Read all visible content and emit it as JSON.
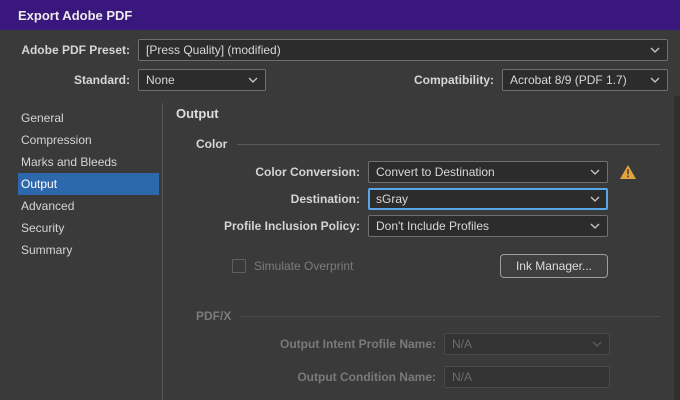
{
  "title": "Export Adobe PDF",
  "top": {
    "preset_label": "Adobe PDF Preset:",
    "preset_value": "[Press Quality] (modified)",
    "standard_label": "Standard:",
    "standard_value": "None",
    "compatibility_label": "Compatibility:",
    "compatibility_value": "Acrobat 8/9 (PDF 1.7)"
  },
  "sidebar": {
    "items": [
      {
        "label": "General",
        "selected": false
      },
      {
        "label": "Compression",
        "selected": false
      },
      {
        "label": "Marks and Bleeds",
        "selected": false
      },
      {
        "label": "Output",
        "selected": true
      },
      {
        "label": "Advanced",
        "selected": false
      },
      {
        "label": "Security",
        "selected": false
      },
      {
        "label": "Summary",
        "selected": false
      }
    ]
  },
  "panel": {
    "title": "Output",
    "color": {
      "title": "Color",
      "conversion_label": "Color Conversion:",
      "conversion_value": "Convert to Destination",
      "destination_label": "Destination:",
      "destination_value": "sGray",
      "policy_label": "Profile Inclusion Policy:",
      "policy_value": "Don't Include Profiles",
      "simulate_overprint_label": "Simulate Overprint",
      "ink_manager_label": "Ink Manager..."
    },
    "pdfx": {
      "title": "PDF/X",
      "intent_label": "Output Intent Profile Name:",
      "intent_value": "N/A",
      "condition_label": "Output Condition Name:",
      "condition_value": "N/A"
    }
  },
  "colors": {
    "titlebar": "#39177c",
    "selection": "#2d68ad",
    "focus": "#5aa7e8",
    "warning": "#e2a33d"
  }
}
